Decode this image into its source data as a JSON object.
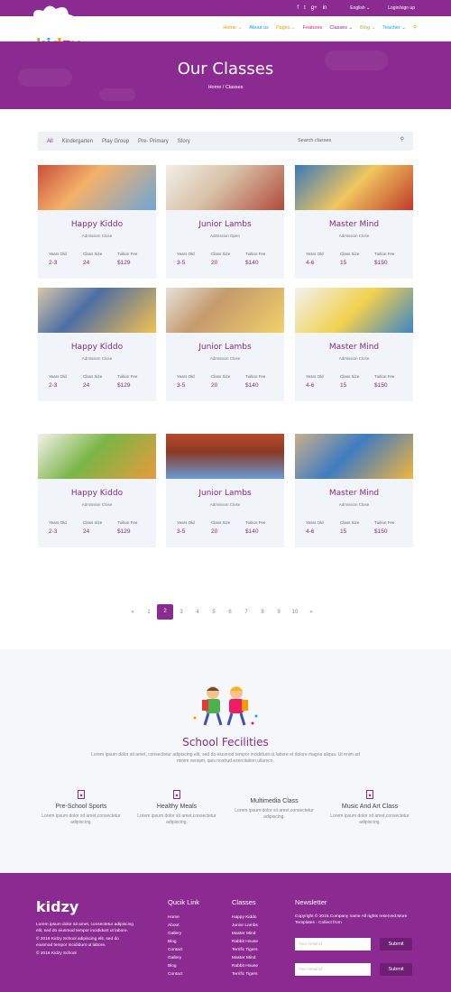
{
  "topbar": {
    "social": [
      "f",
      "t",
      "g+",
      "in"
    ],
    "language": "English ⌄",
    "login": "Login/sign up"
  },
  "logo": "kidzy",
  "menu": [
    {
      "label": "Home ⌄"
    },
    {
      "label": "About us"
    },
    {
      "label": "Pages ⌄"
    },
    {
      "label": "Features"
    },
    {
      "label": "Classes ⌄"
    },
    {
      "label": "Blog ⌄"
    },
    {
      "label": "Teacher ⌄"
    }
  ],
  "menu_search_icon": "search-icon",
  "hero": {
    "title": "Our Classes",
    "breadcrumb": "Home / Classes"
  },
  "filters": {
    "items": [
      "All",
      "Kindergarten",
      "Play Group",
      "Pre- Primary",
      "Story"
    ],
    "placeholder": "Search classes"
  },
  "cards": [
    {
      "title": "Happy Kiddo",
      "admission": "Admission Close",
      "age_lbl": "Years Old",
      "age": "2-3",
      "size_lbl": "Class Size",
      "size": "24",
      "fee_lbl": "Tuition Fee",
      "fee": "$129"
    },
    {
      "title": "Junior Lambs",
      "admission": "Admission Open",
      "age_lbl": "Years Old",
      "age": "3-5",
      "size_lbl": "Class Size",
      "size": "20",
      "fee_lbl": "Tuition Fee",
      "fee": "$140"
    },
    {
      "title": "Master Mind",
      "admission": "Admission Close",
      "age_lbl": "Years Old",
      "age": "4-6",
      "size_lbl": "Class Size",
      "size": "15",
      "fee_lbl": "Tuition Fee",
      "fee": "$150"
    },
    {
      "title": "Happy Kiddo",
      "admission": "Admission Close",
      "age_lbl": "Years Old",
      "age": "2-3",
      "size_lbl": "Class Size",
      "size": "24",
      "fee_lbl": "Tuition Fee",
      "fee": "$129"
    },
    {
      "title": "Junior Lambs",
      "admission": "Admission Close",
      "age_lbl": "Years Old",
      "age": "3-5",
      "size_lbl": "Class Size",
      "size": "20",
      "fee_lbl": "Tuition Fee",
      "fee": "$140"
    },
    {
      "title": "Master Mind",
      "admission": "Admission Close",
      "age_lbl": "Years Old",
      "age": "4-6",
      "size_lbl": "Class Size",
      "size": "15",
      "fee_lbl": "Tuition Fee",
      "fee": "$150"
    },
    {
      "title": "Happy Kiddo",
      "admission": "Admission Close",
      "age_lbl": "Years Old",
      "age": "2-3",
      "size_lbl": "Class Size",
      "size": "24",
      "fee_lbl": "Tuition Fee",
      "fee": "$129"
    },
    {
      "title": "Junior Lambs",
      "admission": "Admission Close",
      "age_lbl": "Years Old",
      "age": "3-5",
      "size_lbl": "Class Size",
      "size": "20",
      "fee_lbl": "Tuition Fee",
      "fee": "$140"
    },
    {
      "title": "Master Mind",
      "admission": "Admission Close",
      "age_lbl": "Years Old",
      "age": "4-6",
      "size_lbl": "Class Size",
      "size": "15",
      "fee_lbl": "Tuition Fee",
      "fee": "$150"
    }
  ],
  "pagination": {
    "prev": "«",
    "pages": [
      "1",
      "2",
      "3",
      "4",
      "5",
      "6",
      "7",
      "8",
      "9",
      "10"
    ],
    "current": "2",
    "next": "»"
  },
  "facilities": {
    "title": "School Fecilities",
    "desc": "Lorem ipsum dolor sit amet, consectetur adipiscing elit, sed do eiusmod tempor incididunt ut labore et dolore magna aliqua. Ut enim ad minim veniam, quis nostrud exercitation ullamco.",
    "items": [
      {
        "title": "Pre-School Sports",
        "desc": "Lorem ipsum dolor sit amet,consectetur adipiscing."
      },
      {
        "title": "Healthy Meals",
        "desc": "Lorem ipsum dolor sit amet,consectetur adipiscing."
      },
      {
        "title": "Multimedia Class",
        "desc": "Lorem ipsum dolor sit amet,consectetur adipiscing."
      },
      {
        "title": "Music And Art Class",
        "desc": "Lorem ipsum dolor sit amet,consectetur adipiscing."
      }
    ]
  },
  "footer": {
    "logo": "kidzy",
    "about": "Lorem ipsum dolor sit amet, consectetur adipiscing elit, sed do eiusmod tempor incididunt ut labore.",
    "about2": "© 2016 Kidzy School adipiscing elit, sed do eiusmod tempor incididunt ut labore.",
    "about3": "© 2016 Kidzy School",
    "quick_title": "Qucik Link",
    "quick": [
      "Home",
      "About",
      "Gallery",
      "Blog",
      "Contact",
      "Gallery",
      "Blog",
      "Contact"
    ],
    "classes_title": "Classes",
    "classes": [
      "Happy Kiddo",
      "Junior Lambs",
      "Master Mind",
      "Rabbit House",
      "Terrific Tigers",
      "Master Mind",
      "Rabbit House",
      "Terrific Tigers"
    ],
    "news_title": "Newsletter",
    "news_text": "Copyright © 2016.Company name All rights reserved.More Templates - Collect from",
    "email_placeholder": "Your email id",
    "submit": "Submit"
  },
  "colors": {
    "brand": "#8b2a90"
  }
}
